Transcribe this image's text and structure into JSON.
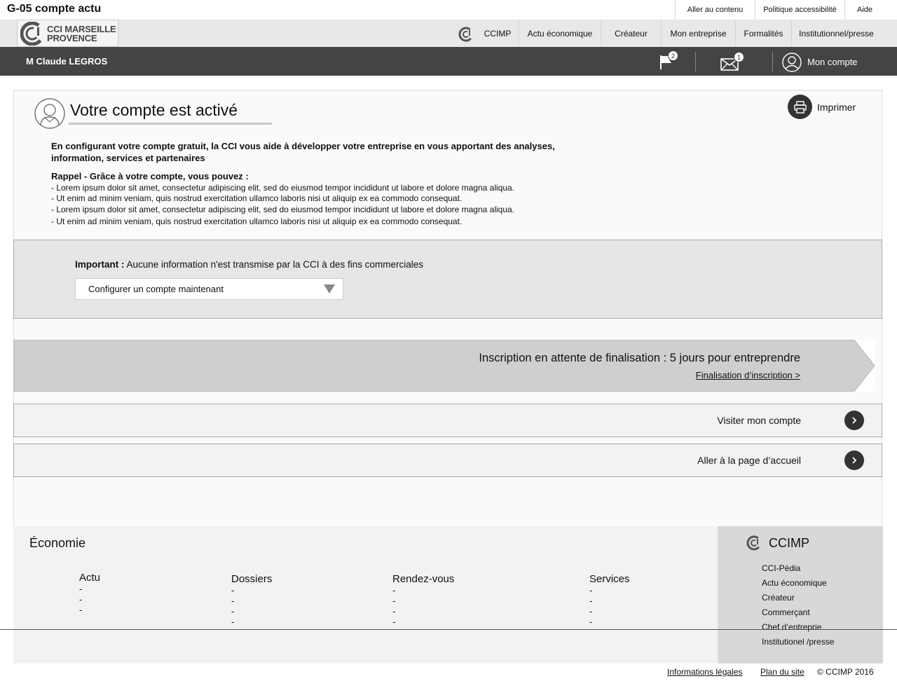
{
  "page": {
    "title": "G-05 compte actu"
  },
  "top_links": [
    "Aller au contenu",
    "Politique accessibilité",
    "Aide"
  ],
  "logo": {
    "line1": "CCI MARSEILLE",
    "line2": "PROVENCE"
  },
  "nav": {
    "ccimp": "CCIMP",
    "items": [
      "Actu économique",
      "Créateur",
      "Mon entreprise",
      "Formalités",
      "Institutionnel/presse"
    ]
  },
  "userbar": {
    "user_name": "M Claude LEGROS",
    "flag_count": "2",
    "mail_count": "1",
    "account_label": "Mon compte"
  },
  "main": {
    "title": "Votre compte est activé",
    "print_label": "Imprimer",
    "intro": "En configurant votre compte gratuit, la CCI vous aide à développer votre entreprise en vous apportant des analyses, information, services et partenaires",
    "rappel_title": "Rappel - Grâce à votre compte, vous pouvez :",
    "rappel_items": [
      "- Lorem ipsum dolor sit amet, consectetur adipiscing elit, sed do eiusmod tempor incididunt ut labore et dolore magna aliqua.",
      "- Ut enim ad minim veniam, quis nostrud exercitation ullamco laboris nisi ut aliquip ex ea commodo consequat.",
      "- Lorem ipsum dolor sit amet, consectetur adipiscing elit, sed do eiusmod tempor incididunt ut labore et dolore magna aliqua.",
      "- Ut enim ad minim veniam, quis nostrud exercitation ullamco laboris nisi ut aliquip ex ea commodo consequat."
    ]
  },
  "important": {
    "label": "Important :",
    "text": " Aucune information n'est transmise par la CCI à des fins commerciales",
    "select_value": "Configurer un compte maintenant"
  },
  "inscription": {
    "text": "Inscription en attente de finalisation : 5 jours pour entreprendre",
    "link": "Finalisation d’inscription  >"
  },
  "actions": {
    "visit_account": "Visiter mon compte",
    "home": "Aller à la page d’accueil"
  },
  "footer": {
    "economie_title": "Économie",
    "columns": [
      {
        "title": "Actu",
        "dashes": [
          "-",
          "-",
          "-"
        ]
      },
      {
        "title": "Dossiers",
        "dashes": [
          "-",
          "-",
          "-",
          "-"
        ]
      },
      {
        "title": "Rendez-vous",
        "dashes": [
          "-",
          "-",
          "-",
          "-"
        ]
      },
      {
        "title": "Services",
        "dashes": [
          "-",
          "-",
          "-",
          "-"
        ]
      }
    ],
    "ccimp_title": "CCIMP",
    "ccimp_links": [
      "CCI-Pédia",
      "Actu économique",
      "Créateur",
      "Commerçant",
      "Chef d’entreprie",
      "Institutionel /presse"
    ]
  },
  "bottom": {
    "legal": "Informations légales",
    "sitemap": "Plan du site",
    "copyright": "© CCIMP 2016"
  },
  "colors": {
    "dark_bar": "#444444",
    "nav_bg": "#e8e8e8",
    "important_bg": "#e6e6e6",
    "banner_bg": "#cfcfcf",
    "divider_red": "#b22222"
  }
}
